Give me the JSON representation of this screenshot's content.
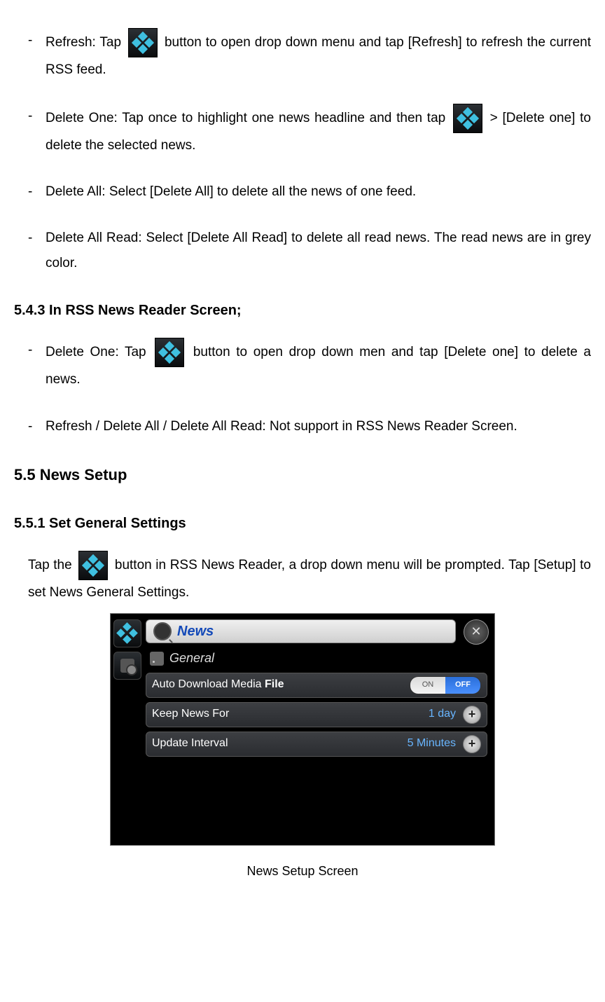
{
  "bullets1": {
    "refresh": {
      "pre": "Refresh: Tap ",
      "post1": " button to open ",
      "mid": "drop down menu",
      "post2": " and tap [Refresh] to refresh the current RSS feed."
    },
    "deleteOne": {
      "pre": "Delete One: Tap once to highlight one news headline and then tap ",
      "gt": " > ",
      "post": "[Delete one] to delete the selected news."
    },
    "deleteAll": "Delete All: Select [Delete All] to delete all the news of one feed.",
    "deleteAllRead": "Delete All Read: Select [Delete All Read] to delete all read news. The read news are in grey color."
  },
  "heading543": "5.4.3 In RSS News Reader Screen;",
  "bullets2": {
    "deleteOne": {
      "pre": "Delete One: Tap ",
      "post1": " button to open ",
      "mid": "drop down men",
      "post2": " and tap [Delete one] to delete a news."
    },
    "notSupport": "Refresh / Delete All / Delete All Read: Not support in RSS News Reader Screen."
  },
  "heading55": "5.5 News Setup",
  "heading551": "5.5.1 Set General Settings",
  "para551": {
    "pre": "Tap the ",
    "post": " button in RSS News Reader, a drop down menu will be prompted. Tap [Setup] to set News General Settings."
  },
  "screenshot": {
    "title": "News",
    "section": "General",
    "row1": {
      "label_a": "Auto Download Media ",
      "label_b": "File",
      "on": "ON",
      "off": "OFF"
    },
    "row2": {
      "label": "Keep News For",
      "value": "1 day"
    },
    "row3": {
      "label": "Update Interval",
      "value": "5 Minutes"
    },
    "close": "✕",
    "plus": "+"
  },
  "caption": "News Setup Screen",
  "dash": "-"
}
